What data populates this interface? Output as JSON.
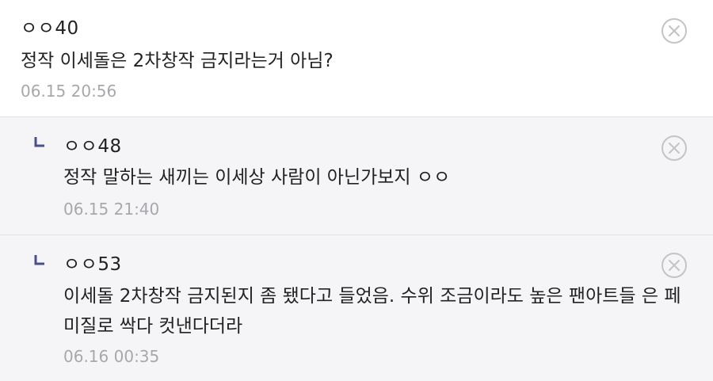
{
  "comments": [
    {
      "author": "ㅇㅇ40",
      "text": "정작 이세돌은 2차창작 금지라는거 아님?",
      "time": "06.15 20:56"
    },
    {
      "author": "ㅇㅇ48",
      "text": "정작 말하는 새끼는 이세상 사람이 아닌가보지 ㅇㅇ",
      "time": "06.15 21:40"
    },
    {
      "author": "ㅇㅇ53",
      "text": "이세돌 2차창작 금지된지 좀 됐다고 들었음. 수위 조금이라도 높은 팬아트들 은 페미질로 싹다 컷낸다더라",
      "time": "06.16 00:35"
    }
  ],
  "icons": {
    "reply": "reply-arrow-icon",
    "delete": "delete-circle-x-icon"
  },
  "colors": {
    "reply_mark": "#4a4f8c",
    "timestamp": "#a8a8ac",
    "delete_icon": "#c4c4c8",
    "reply_background": "#f5f5f7"
  }
}
